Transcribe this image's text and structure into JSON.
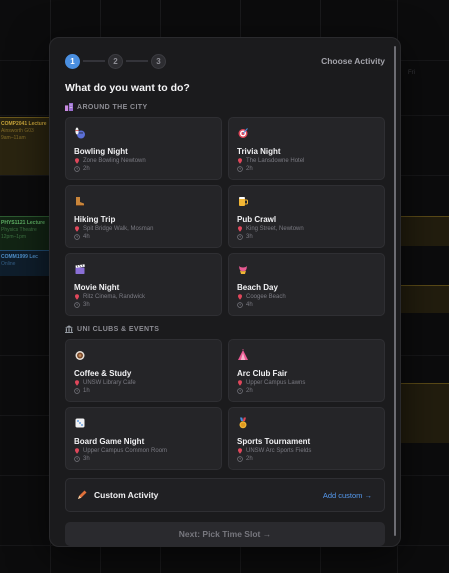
{
  "background": {
    "day_label": "Fri",
    "events": [
      {
        "title": "COMP2041 Lecture",
        "sub": "Ainsworth G03",
        "sub2": "9am–11am"
      },
      {
        "title": "PHYS1121 Lecture",
        "sub": "Physics Theatre",
        "sub2": "12pm–1pm"
      },
      {
        "title": "COMM1999 Lec",
        "sub": "Online",
        "sub2": ""
      }
    ]
  },
  "modal": {
    "steps": [
      "1",
      "2",
      "3"
    ],
    "header_right": "Choose Activity",
    "question": "What do you want to do?",
    "sections": [
      {
        "title": "AROUND THE CITY",
        "icon": "city-icon",
        "activities": [
          {
            "name": "Bowling Night",
            "location": "Zone Bowling Newtown",
            "duration": "2h",
            "icon": "bowling-icon"
          },
          {
            "name": "Trivia Night",
            "location": "The Lansdowne Hotel",
            "duration": "2h",
            "icon": "target-icon"
          },
          {
            "name": "Hiking Trip",
            "location": "Spit Bridge Walk, Mosman",
            "duration": "4h",
            "icon": "boot-icon"
          },
          {
            "name": "Pub Crawl",
            "location": "King Street, Newtown",
            "duration": "3h",
            "icon": "beer-icon"
          },
          {
            "name": "Movie Night",
            "location": "Ritz Cinema, Randwick",
            "duration": "3h",
            "icon": "clapper-icon"
          },
          {
            "name": "Beach Day",
            "location": "Coogee Beach",
            "duration": "4h",
            "icon": "swimsuit-icon"
          }
        ]
      },
      {
        "title": "UNI CLUBS & EVENTS",
        "icon": "university-icon",
        "activities": [
          {
            "name": "Coffee & Study",
            "location": "UNSW Library Cafe",
            "duration": "1h",
            "icon": "coffee-icon"
          },
          {
            "name": "Arc Club Fair",
            "location": "Upper Campus Lawns",
            "duration": "2h",
            "icon": "tent-icon"
          },
          {
            "name": "Board Game Night",
            "location": "Upper Campus Common Room",
            "duration": "3h",
            "icon": "dice-icon"
          },
          {
            "name": "Sports Tournament",
            "location": "UNSW Arc Sports Fields",
            "duration": "2h",
            "icon": "medal-icon"
          }
        ]
      }
    ],
    "custom": {
      "label": "Custom Activity",
      "link": "Add custom →",
      "icon": "pencil-icon"
    },
    "next_button": "Next: Pick Time Slot →"
  },
  "colors": {
    "accent": "#4a8fe0",
    "link": "#5599ee",
    "panel": "#1b1b1d",
    "card": "#252528"
  }
}
